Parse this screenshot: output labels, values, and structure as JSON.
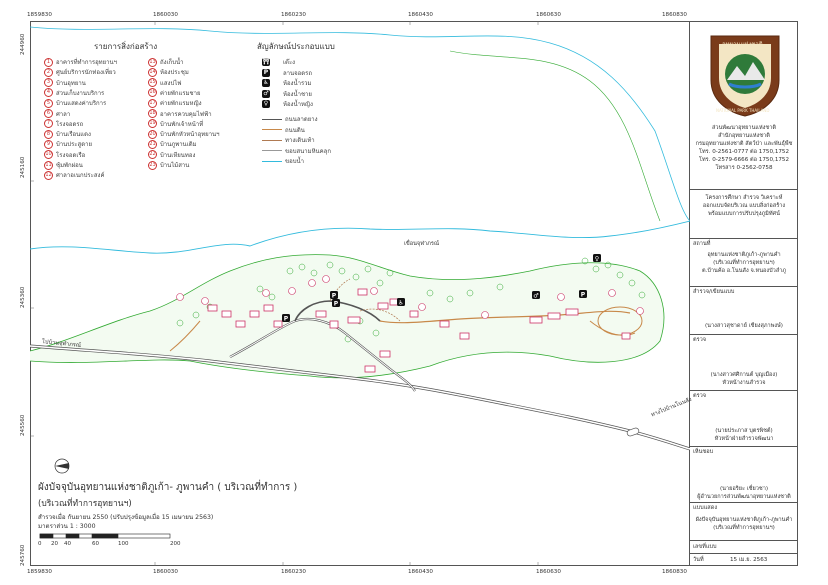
{
  "coords": {
    "top": [
      "1859830",
      "1860030",
      "1860230",
      "1860430",
      "1860630",
      "1860830"
    ],
    "bottom": [
      "1859830",
      "1860030",
      "1860230",
      "1860430",
      "1860630",
      "1860830"
    ],
    "left": [
      "245760",
      "245560",
      "245360",
      "245160",
      "244960"
    ]
  },
  "legend_buildings": {
    "title": "รายการสิ่งก่อสร้าง",
    "col1": [
      {
        "n": "1",
        "label": "อาคารที่ทำการอุทยานฯ"
      },
      {
        "n": "2",
        "label": "ศูนย์บริการนักท่องเที่ยว"
      },
      {
        "n": "3",
        "label": "บ้านอุทยาน"
      },
      {
        "n": "4",
        "label": "ส่วนเก็บงานบริการ"
      },
      {
        "n": "5",
        "label": "บ้านแสดงค่าบริการ"
      },
      {
        "n": "6",
        "label": "ศาลา"
      },
      {
        "n": "7",
        "label": "โรงจอดรถ"
      },
      {
        "n": "8",
        "label": "บ้านเรือนแดง"
      },
      {
        "n": "9",
        "label": "บ้านประสูดาย"
      },
      {
        "n": "10",
        "label": "โรงจอดเรือ"
      },
      {
        "n": "11",
        "label": "ซุ้มพักผ่อน"
      },
      {
        "n": "12",
        "label": "ศาลาอเนกประสงค์"
      }
    ],
    "col2": [
      {
        "n": "13",
        "label": "ถังเก็บน้ำ"
      },
      {
        "n": "14",
        "label": "ห้องประชุม"
      },
      {
        "n": "15",
        "label": "แสงปไฟ"
      },
      {
        "n": "16",
        "label": "ค่ายพักแรมชาย"
      },
      {
        "n": "17",
        "label": "ค่ายพักแรมหญิง"
      },
      {
        "n": "18",
        "label": "อาคารควบคุมไฟฟ้า"
      },
      {
        "n": "19",
        "label": "บ้านพักเจ้าหน้าที่"
      },
      {
        "n": "20",
        "label": "บ้านพักหัวหน้าอุทยานฯ"
      },
      {
        "n": "21",
        "label": "บ้านภูพานเดิม"
      },
      {
        "n": "22",
        "label": "บ้านเหียนทอง"
      },
      {
        "n": "23",
        "label": "บ้านไม้สาน"
      }
    ]
  },
  "legend_symbols": {
    "title": "สัญลักษณ์ประกอบแบบ",
    "items": [
      {
        "icon": "shrine-icon",
        "glyph": "⛩",
        "label": "เต๊ะง"
      },
      {
        "icon": "parking-icon",
        "glyph": "P",
        "label": "ลานจอดรถ"
      },
      {
        "icon": "restroom-icon",
        "glyph": "♿",
        "label": "ห้องน้ำรวม"
      },
      {
        "icon": "male-restroom-icon",
        "glyph": "♂",
        "label": "ห้องน้ำชาย"
      },
      {
        "icon": "female-restroom-icon",
        "glyph": "♀",
        "label": "ห้องน้ำหญิง"
      }
    ],
    "lines": [
      {
        "label": "ถนนลาดยาง",
        "color": "#555555"
      },
      {
        "label": "ถนนดิน",
        "color": "#c8894a"
      },
      {
        "label": "ทางเดินเท้า",
        "color": "#b07a52"
      },
      {
        "label": "ขอบสนามหินคลุก",
        "color": "#999999"
      },
      {
        "label": "ขอบน้ำ",
        "color": "#33bbdd"
      }
    ]
  },
  "map_labels": {
    "reservoir": "เขื่อนจุฬาภรณ์",
    "road_left": "ไปบ้านจุฬาภรณ์",
    "road_right": "ทางไปบ้านโนนสัง"
  },
  "title_block": {
    "main_title": "ผังบัจจุบันอุทยานแห่งชาติภูเก้า- ภูพานคำ ( บริเวณที่ทำการ )",
    "sub_title": "(บริเวณที่ทำการอุทยานฯ)",
    "survey": "สำรวจเมื่อ กันยายน 2550 (ปรับปรุงข้อมูลเมื่อ 15 เมษายน 2563)",
    "scale": "มาตราส่วน     1  :  3000",
    "scale_marks": [
      "0",
      "20",
      "40",
      "60",
      "100",
      "200"
    ]
  },
  "agency": {
    "lines": [
      "ส่วนพัฒนาอุทยานแห่งชาติ",
      "สำนักอุทยานแห่งชาติ",
      "กรมอุทยานแห่งชาติ สัตว์ป่า และพันธุ์พืช"
    ],
    "phones": [
      "โทร. 0-2561-0777  ต่อ 1750,1752",
      "โทร. 0-2579-6666  ต่อ 1750,1752",
      "โทรสาร  0-2562-0758"
    ],
    "logo_text": "อุทยานแห่งชาติ",
    "logo_ring": "NATIONAL PARK THAILAND"
  },
  "project": {
    "lines": [
      "โครงการศึกษา  สำรวจ  วิเคราะห์",
      "ออกแบบจัดบริเวณ  แบบสิ่งก่อสร้าง",
      "พร้อมแบบการปรับปรุงภูมิทัศน์"
    ]
  },
  "location": {
    "label": "สถานที่",
    "lines": [
      "อุทยานแห่งชาติภูเก้า-ภูพานคำ",
      "(บริเวณที่ทำการอุทยานฯ)",
      "ต.บ้านค้อ  อ.โนนสัง  จ.หนองบัวลำภู"
    ]
  },
  "designer": {
    "label": "สำรวจ/เขียนแบบ",
    "name": "(นางสาวสุชาดาย์  เชียงสุภาพงษ์)"
  },
  "checker": {
    "label": "ตรวจ",
    "name": "(นางสาวศศิกานต์  บุญเมือง)",
    "role": "หัวหน้างานสำรวจ"
  },
  "approver": {
    "label": "ตรวจ",
    "name": "(นายประภาส  บุตรพิชต์)",
    "role": "หัวหน้าฝ่ายสำรวจพัฒนา"
  },
  "approve2": {
    "label": "เห็นชอบ",
    "name": "(นายอริยะ  เชี่ยวชา)",
    "role": "ผู้อำนวยการส่วนพัฒนาอุทยานแห่งชาติ"
  },
  "drawing": {
    "label": "แบบแสดง",
    "lines": [
      "ผังปัจจุบันอุทยานแห่งชาติภูเก้า-ภูพานคำ",
      "(บริเวณที่ทำการอุทยานฯ)"
    ]
  },
  "sheet": {
    "no_label": "เลขที่แบบ",
    "date_label": "วันที่",
    "date": "15  เม.ย. 2563"
  },
  "colors": {
    "road": "#555555",
    "dirt": "#c8894a",
    "vegetation": "#33aa33",
    "water": "#33bbdd",
    "building": "#cc3366"
  }
}
